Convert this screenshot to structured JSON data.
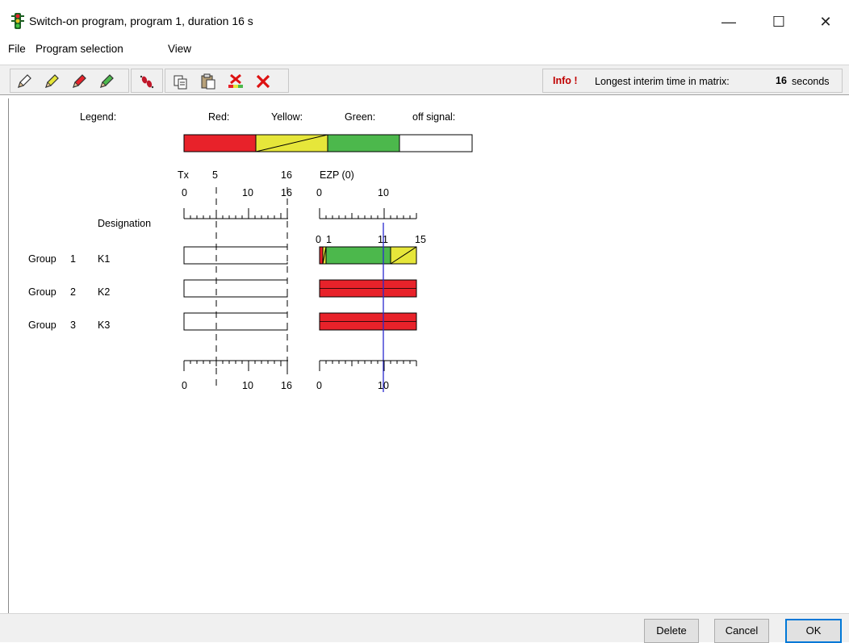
{
  "window": {
    "title": "Switch-on program, program 1, duration 16 s",
    "icon": "traffic-light-icon",
    "controls": {
      "minimize": "—",
      "maximize": "☐",
      "close": "✕"
    }
  },
  "menu": {
    "items": [
      {
        "label": "File"
      },
      {
        "label": "Program selection"
      },
      {
        "label": "View"
      }
    ]
  },
  "toolbar": {
    "icons": [
      "pencil-white-icon",
      "pencil-yellow-icon",
      "pencil-red-icon",
      "pencil-green-icon",
      "footprints-icon",
      "copy-icon",
      "paste-icon",
      "delete-colors-icon",
      "delete-icon"
    ],
    "info_label": "Info !",
    "info_text": "Longest interim time in matrix:",
    "info_value": "16",
    "info_unit": "seconds"
  },
  "legend": {
    "title": "Legend:",
    "red": "Red:",
    "yellow": "Yellow:",
    "green": "Green:",
    "off": "off signal:",
    "colors": {
      "red": "#e8222a",
      "yellow": "#e6e63a",
      "green": "#4cb84c",
      "off": "#ffffff"
    }
  },
  "left_scale": {
    "top_label_tx": "Tx",
    "top_label_5": "5",
    "top_label_16a": "16",
    "top_label_16b": "16",
    "tick_0": "0",
    "tick_10": "10",
    "bottom_0": "0",
    "bottom_10": "10",
    "bottom_16": "16"
  },
  "right_scale": {
    "top_label": "EZP (0)",
    "tick_0": "0",
    "tick_10": "10",
    "mid_0": "0",
    "mid_1": "1",
    "mid_11": "11",
    "mid_15": "15",
    "bottom_0": "0",
    "bottom_10": "10"
  },
  "designation_header": "Designation",
  "groups": [
    {
      "group": "Group",
      "num": "1",
      "name": "K1",
      "phases": [
        {
          "color": "red",
          "from": 0,
          "to": 0.5
        },
        {
          "color": "yellow",
          "from": 0.5,
          "to": 1
        },
        {
          "color": "green",
          "from": 1,
          "to": 11
        },
        {
          "color": "yellow",
          "from": 11,
          "to": 15
        }
      ]
    },
    {
      "group": "Group",
      "num": "2",
      "name": "K2",
      "phases": [
        {
          "color": "red",
          "from": 0,
          "to": 15
        }
      ]
    },
    {
      "group": "Group",
      "num": "3",
      "name": "K3",
      "phases": [
        {
          "color": "red",
          "from": 0,
          "to": 15
        }
      ]
    }
  ],
  "buttons": {
    "delete": "Delete",
    "cancel": "Cancel",
    "ok": "OK"
  }
}
